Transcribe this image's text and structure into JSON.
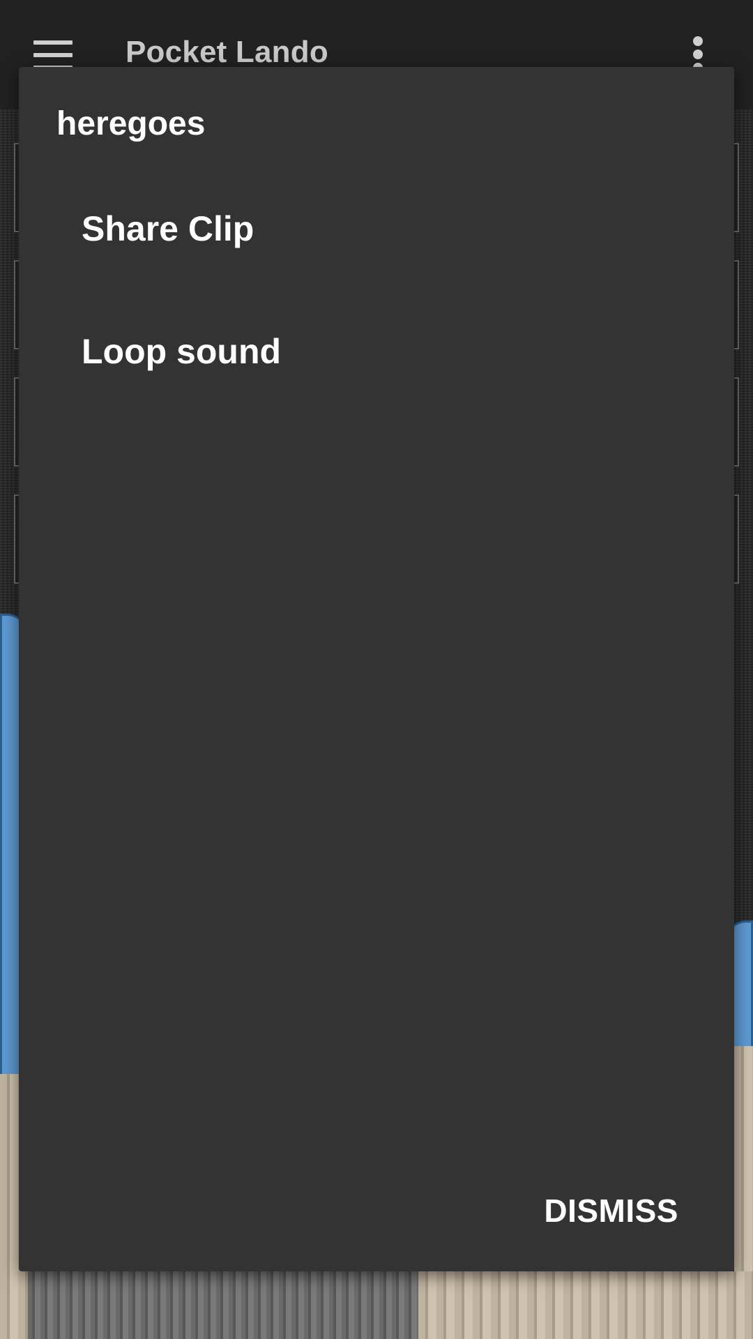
{
  "app_bar": {
    "title": "Pocket Lando",
    "menu_icon": "hamburger-menu-icon",
    "overflow_icon": "more-vert-icon",
    "background": "#212121"
  },
  "dialog": {
    "title": "heregoes",
    "items": [
      {
        "label": "Share Clip"
      },
      {
        "label": "Loop sound"
      }
    ],
    "dismiss_label": "DISMISS",
    "background": "#333333"
  }
}
